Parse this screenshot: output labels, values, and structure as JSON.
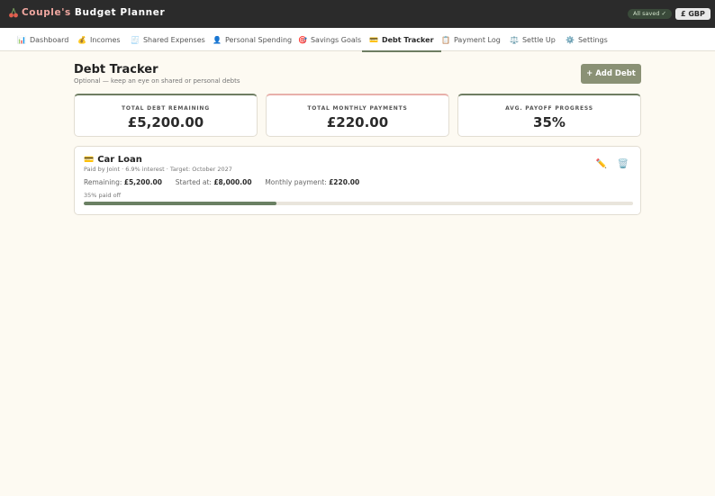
{
  "app": {
    "title_accent": "Couple's",
    "title_rest": "Budget Planner",
    "saved_status": "All saved ✓",
    "currency": "£ GBP"
  },
  "nav": {
    "tabs": [
      {
        "icon": "📊",
        "label": "Dashboard"
      },
      {
        "icon": "💰",
        "label": "Incomes"
      },
      {
        "icon": "🧾",
        "label": "Shared Expenses"
      },
      {
        "icon": "👤",
        "label": "Personal Spending"
      },
      {
        "icon": "🎯",
        "label": "Savings Goals"
      },
      {
        "icon": "💳",
        "label": "Debt Tracker"
      },
      {
        "icon": "📋",
        "label": "Payment Log"
      },
      {
        "icon": "⚖️",
        "label": "Settle Up"
      },
      {
        "icon": "⚙️",
        "label": "Settings"
      }
    ],
    "active": "Debt Tracker"
  },
  "page": {
    "title": "Debt Tracker",
    "subtitle": "Optional — keep an eye on shared or personal debts",
    "add_button": "+ Add Debt"
  },
  "stats": [
    {
      "label": "TOTAL DEBT REMAINING",
      "value": "£5,200.00"
    },
    {
      "label": "TOTAL MONTHLY PAYMENTS",
      "value": "£220.00"
    },
    {
      "label": "AVG. PAYOFF PROGRESS",
      "value": "35%"
    }
  ],
  "debts": [
    {
      "icon": "💳",
      "name": "Car Loan",
      "meta": "Paid by Joint · 6.9% interest · Target: October 2027",
      "remaining_label": "Remaining:",
      "remaining": "£5,200.00",
      "started_label": "Started at:",
      "started": "£8,000.00",
      "monthly_label": "Monthly payment:",
      "monthly": "£220.00",
      "paid_off_text": "35% paid off",
      "progress_percent": 35,
      "edit_icon": "✏️",
      "delete_icon": "🗑️"
    }
  ],
  "colors": {
    "topbar": "#2b2b2b",
    "accent": "#6e7d62",
    "progress": "#6a8063",
    "add_button": "#8a9175",
    "pink_accent": "#e8b0aa"
  }
}
